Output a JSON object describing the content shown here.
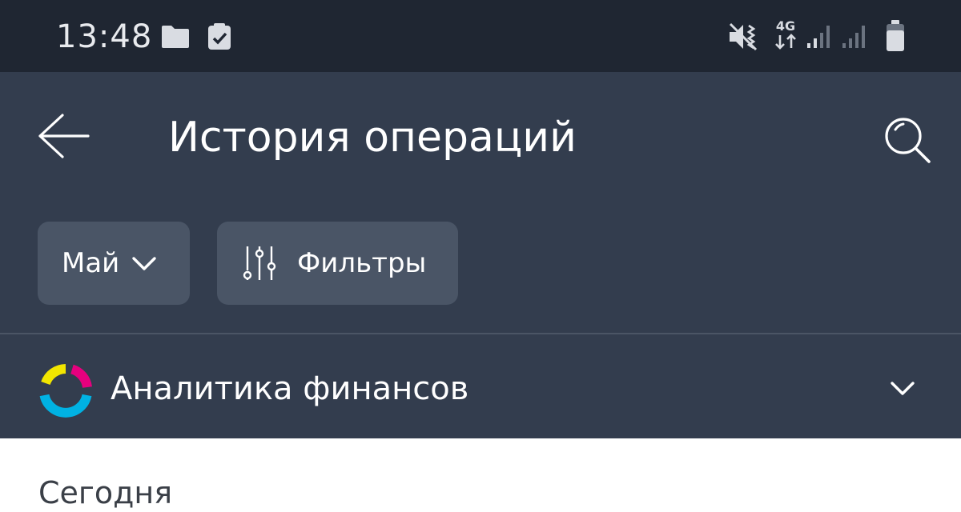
{
  "status_bar": {
    "time": "13:48",
    "left_icons": [
      "folder-icon",
      "checkbox-icon"
    ],
    "right_icons": [
      "vibrate-icon",
      "4g-icon",
      "signal-icon",
      "signal-icon",
      "battery-icon"
    ],
    "network_label": "4G"
  },
  "app_bar": {
    "title": "История операций",
    "back_icon": "arrow-left-icon",
    "search_icon": "search-icon"
  },
  "filters": {
    "month_label": "Май",
    "filters_label": "Фильтры"
  },
  "analytics": {
    "label": "Аналитика финансов",
    "logo_colors": [
      "#f2e600",
      "#e6007e",
      "#00b2e3"
    ]
  },
  "content": {
    "section_date": "Сегодня"
  },
  "colors": {
    "status_bar_bg": "#1f2632",
    "app_bar_bg": "#333d4e",
    "chip_bg": "#4a5566"
  }
}
